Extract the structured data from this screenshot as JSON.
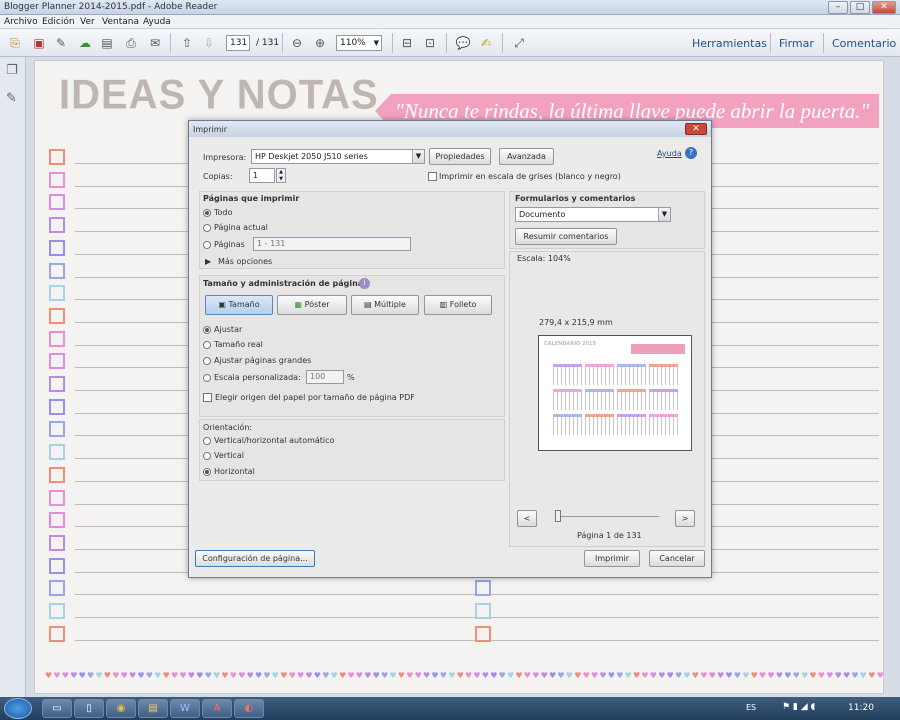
{
  "window": {
    "title": "Blogger Planner 2014-2015.pdf - Adobe Reader",
    "min": "–",
    "max": "□",
    "close": "✕"
  },
  "menu": [
    "Archivo",
    "Edición",
    "Ver",
    "Ventana",
    "Ayuda"
  ],
  "toolbar": {
    "page_current": "131",
    "page_total": "/ 131",
    "zoom": "110%",
    "links": [
      "Herramientas",
      "Firmar",
      "Comentario"
    ]
  },
  "page": {
    "title": "IDEAS Y NOTAS",
    "quote": "\"Nunca te rindas, la última llave puede abrir la puerta.\"",
    "checkbox_colors": [
      "#ee8e7a",
      "#ea8fd0",
      "#e08ae0",
      "#b98ae8",
      "#9a8ee8",
      "#9aa6e6",
      "#a6d2e6",
      "#ee8e7a",
      "#ea8fd0",
      "#e08ae0",
      "#b98ae8",
      "#9a8ee8",
      "#9aa6e6",
      "#a6d2e6",
      "#ee8e7a",
      "#ea8fd0",
      "#e08ae0",
      "#b98ae8",
      "#9a8ee8",
      "#9aa6e6",
      "#a6d2e6",
      "#ee8e7a"
    ],
    "heart_colors": [
      "#ee8e7a",
      "#ea8fd0",
      "#e08ae0",
      "#b98ae8",
      "#9a8ee8",
      "#9aa6e6",
      "#a6d2e6"
    ]
  },
  "dialog": {
    "title": "Imprimir",
    "printer_label": "Impresora:",
    "printer_value": "HP Deskjet 2050 J510 series",
    "properties_button": "Propiedades",
    "advanced_button": "Avanzada",
    "help_link": "Ayuda",
    "copies_label": "Copias:",
    "copies_value": "1",
    "grayscale_label": "Imprimir en escala de grises (blanco y negro)",
    "pages_heading": "Páginas que imprimir",
    "pages_options": [
      "Todo",
      "Página actual",
      "Páginas"
    ],
    "pages_range": "1 - 131",
    "more_options": "Más opciones",
    "size_heading": "Tamaño y administración de páginas",
    "size_tabs": [
      "Tamaño",
      "Póster",
      "Múltiple",
      "Folleto"
    ],
    "size_options": [
      "Ajustar",
      "Tamaño real",
      "Ajustar páginas grandes",
      "Escala personalizada:"
    ],
    "scale_value": "100",
    "scale_unit": "%",
    "paper_source_label": "Elegir origen del papel por tamaño de página PDF",
    "orientation_heading": "Orientación:",
    "orientation_options": [
      "Vertical/horizontal automático",
      "Vertical",
      "Horizontal"
    ],
    "forms_heading": "Formularios y comentarios",
    "forms_value": "Documento",
    "summarize_button": "Resumir comentarios",
    "scale_text": "Escala: 104%",
    "paper_size": "279,4 x 215,9 mm",
    "preview_title": "CALENDARIO 2015",
    "page_indicator": "Página 1 de 131",
    "page_setup_button": "Configuración de página...",
    "print_button": "Imprimir",
    "cancel_button": "Cancelar",
    "prev": "<",
    "next": ">"
  },
  "taskbar": {
    "language": "ES",
    "time": "11:20"
  }
}
